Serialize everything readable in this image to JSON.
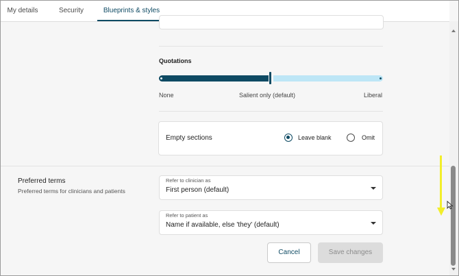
{
  "tabs": [
    {
      "label": "My details",
      "active": false
    },
    {
      "label": "Security",
      "active": false
    },
    {
      "label": "Blueprints & styles",
      "active": true
    }
  ],
  "quotations": {
    "heading": "Quotations",
    "value": "Salient only (default)",
    "labels": [
      "None",
      "Salient only (default)",
      "Liberal"
    ]
  },
  "empty_sections": {
    "title": "Empty sections",
    "options": [
      {
        "label": "Leave blank",
        "selected": true
      },
      {
        "label": "Omit",
        "selected": false
      }
    ]
  },
  "preferred_terms": {
    "title": "Preferred terms",
    "description": "Preferred terms for clinicians and patients",
    "clinician": {
      "label": "Refer to clinician as",
      "value": "First person (default)"
    },
    "patient": {
      "label": "Refer to patient as",
      "value": "Name if available, else 'they' (default)"
    }
  },
  "buttons": {
    "cancel": "Cancel",
    "save": "Save changes"
  },
  "colors": {
    "accent": "#0e4a63",
    "slider_inactive": "#bde6f6",
    "annotation": "#f2ee2a"
  }
}
